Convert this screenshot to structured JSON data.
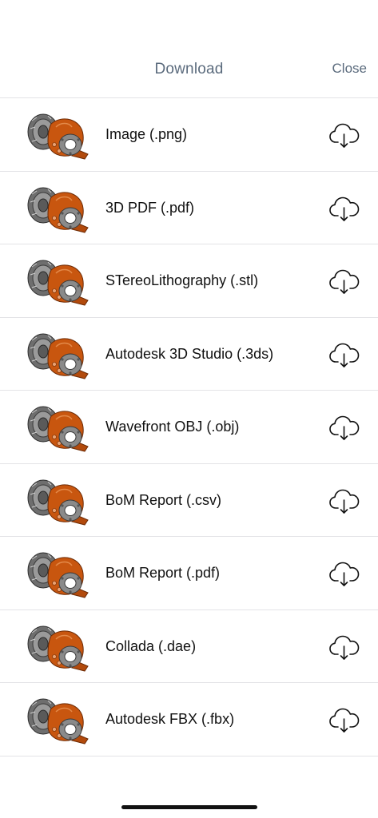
{
  "header": {
    "title": "Download",
    "close_label": "Close"
  },
  "colors": {
    "nav_text": "#5b6b7d",
    "divider": "#e3e3e6",
    "part_orange": "#c8560f",
    "part_grey": "#8a8a8a"
  },
  "formats": [
    {
      "label": "Image (.png)",
      "icon": "cloud-download-icon"
    },
    {
      "label": "3D PDF (.pdf)",
      "icon": "cloud-download-icon"
    },
    {
      "label": "STereoLithography (.stl)",
      "icon": "cloud-download-icon"
    },
    {
      "label": "Autodesk 3D Studio (.3ds)",
      "icon": "cloud-download-icon"
    },
    {
      "label": "Wavefront OBJ (.obj)",
      "icon": "cloud-download-icon"
    },
    {
      "label": "BoM Report (.csv)",
      "icon": "cloud-download-icon"
    },
    {
      "label": "BoM Report (.pdf)",
      "icon": "cloud-download-icon"
    },
    {
      "label": "Collada (.dae)",
      "icon": "cloud-download-icon"
    },
    {
      "label": "Autodesk FBX (.fbx)",
      "icon": "cloud-download-icon"
    }
  ]
}
